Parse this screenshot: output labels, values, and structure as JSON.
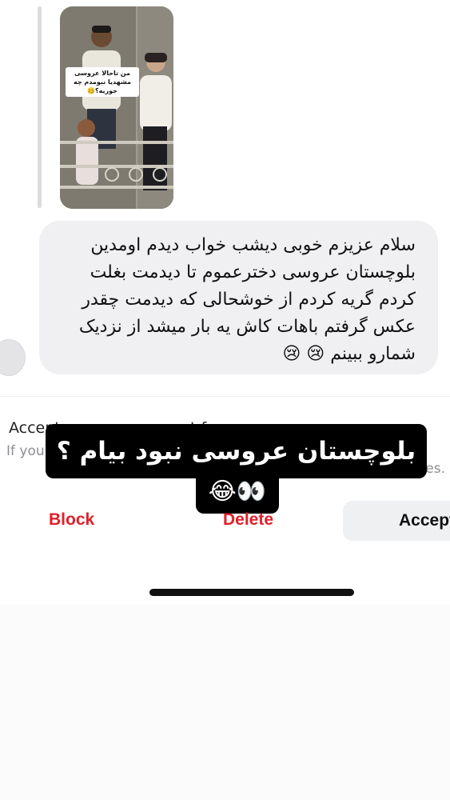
{
  "story": {
    "caption": "من تاحالا عروسی مشهدیا نبومدم چه جوریه؟🥴"
  },
  "message": {
    "text": "سلام عزیزم خوبی دیشب خواب دیدم اومدین بلوچستان عروسی دخترعموم تا دیدمت بغلت کردم گریه کردم از خوشحالی که دیدمت چقدر عکس گرفتم باهات کاش یه بار میشد از نزدیک شمارو ببینم 😢 😢"
  },
  "request": {
    "title": "Accept message request from",
    "subtitle": "If you",
    "subtitle_end": "es."
  },
  "overlay": {
    "line1": "بلوچستان عروسی نبود بیام ؟",
    "line2": "😂👀"
  },
  "actions": {
    "block": "Block",
    "delete": "Delete",
    "accept": "Accept"
  },
  "colors": {
    "danger": "#e0202a",
    "bubble": "#f0f0f2",
    "overlay_bg": "#000000"
  }
}
